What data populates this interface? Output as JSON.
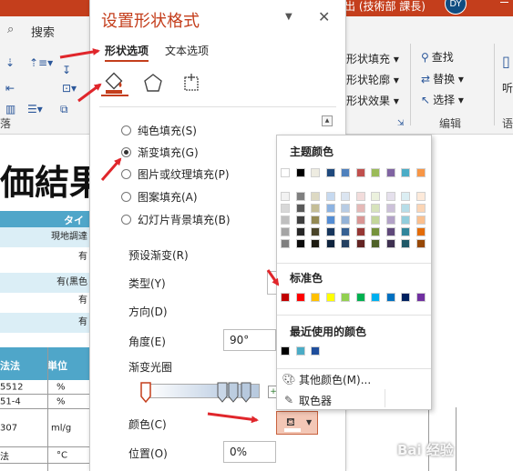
{
  "titlebar": {
    "account_text": "出 (技術部 課長)",
    "avatar": "DY"
  },
  "ribbon": {
    "search_tab": "搜索",
    "shape_fill": "形状填充",
    "shape_outline": "形状轮廓",
    "shape_effects": "形状效果",
    "find": "查找",
    "replace": "替换",
    "select": "选择",
    "group_editing": "编辑",
    "group_left": "落",
    "right_cut": "听",
    "right_cut2": "语"
  },
  "document": {
    "heading": "価結果",
    "table_header": "タイ",
    "rows": [
      "現地調達",
      "有",
      "有(黒色",
      "有",
      "有"
    ],
    "grid_header_col1": "法法",
    "grid_header_col2": "単位",
    "grid_rows": [
      {
        "c1": "5512",
        "c2": "%"
      },
      {
        "c1": "51-4",
        "c2": "%"
      },
      {
        "c1": "307",
        "c2": "ml/g"
      },
      {
        "c1": "法",
        "c2": "°C"
      }
    ]
  },
  "pane": {
    "title": "设置形状格式",
    "tabs": [
      "形状选项",
      "文本选项"
    ],
    "fill_options": [
      {
        "label": "纯色填充(S)",
        "selected": false
      },
      {
        "label": "渐变填充(G)",
        "selected": true
      },
      {
        "label": "图片或纹理填充(P)",
        "selected": false
      },
      {
        "label": "图案填充(A)",
        "selected": false
      },
      {
        "label": "幻灯片背景填充(B)",
        "selected": false
      }
    ],
    "preset_label": "预设渐变(R)",
    "type_label": "类型(Y)",
    "direction_label": "方向(D)",
    "angle_label": "角度(E)",
    "angle_value": "90°",
    "gradient_stops_label": "渐变光圈",
    "color_label": "颜色(C)",
    "position_label": "位置(O)",
    "position_value": "0%",
    "fill_color": "#ffffff",
    "accent": "#c43e1c"
  },
  "color_popup": {
    "theme_colors_label": "主题颜色",
    "standard_colors_label": "标准色",
    "recent_colors_label": "最近使用的颜色",
    "more_colors": "其他颜色(M)...",
    "eyedropper": "取色器",
    "theme_top": [
      "#ffffff",
      "#000000",
      "#e7e6e6",
      "#44546a",
      "#4472c4",
      "#ed7d31",
      "#a5a5a5",
      "#ffc000",
      "#5b9bd5",
      "#70ad47"
    ],
    "theme_base": [
      "#ffffff",
      "#000000",
      "#eeece1",
      "#1f497d",
      "#4f81bd",
      "#c0504d",
      "#9bbb59",
      "#8064a2",
      "#4bacc6",
      "#f79646"
    ],
    "theme_shades": [
      [
        "#f2f2f2",
        "#7f7f7f",
        "#ddd9c3",
        "#c6d9f0",
        "#dbe5f1",
        "#f2dcdb",
        "#ebf1dd",
        "#e5e0ec",
        "#dbeef3",
        "#fdeada"
      ],
      [
        "#d8d8d8",
        "#595959",
        "#c4bd97",
        "#8db3e2",
        "#b8cce4",
        "#e5b9b7",
        "#d7e3bc",
        "#ccc1d9",
        "#b7dde8",
        "#fbd5b5"
      ],
      [
        "#bfbfbf",
        "#3f3f3f",
        "#938953",
        "#548dd4",
        "#95b3d7",
        "#d99694",
        "#c3d69b",
        "#b2a2c7",
        "#92cddc",
        "#fac08f"
      ],
      [
        "#a5a5a5",
        "#262626",
        "#494429",
        "#17365d",
        "#366092",
        "#953734",
        "#76923c",
        "#5f497a",
        "#31859b",
        "#e36c09"
      ],
      [
        "#7f7f7f",
        "#0c0c0c",
        "#1d1b10",
        "#0f243e",
        "#244061",
        "#632423",
        "#4f6128",
        "#3f3151",
        "#205867",
        "#974806"
      ]
    ],
    "standard": [
      "#c00000",
      "#ff0000",
      "#ffc000",
      "#ffff00",
      "#92d050",
      "#00b050",
      "#00b0f0",
      "#0070c0",
      "#002060",
      "#7030a0"
    ],
    "recent": [
      "#000000",
      "#4bacc6",
      "#1f4e9c"
    ]
  },
  "watermark": "Bai 经验"
}
